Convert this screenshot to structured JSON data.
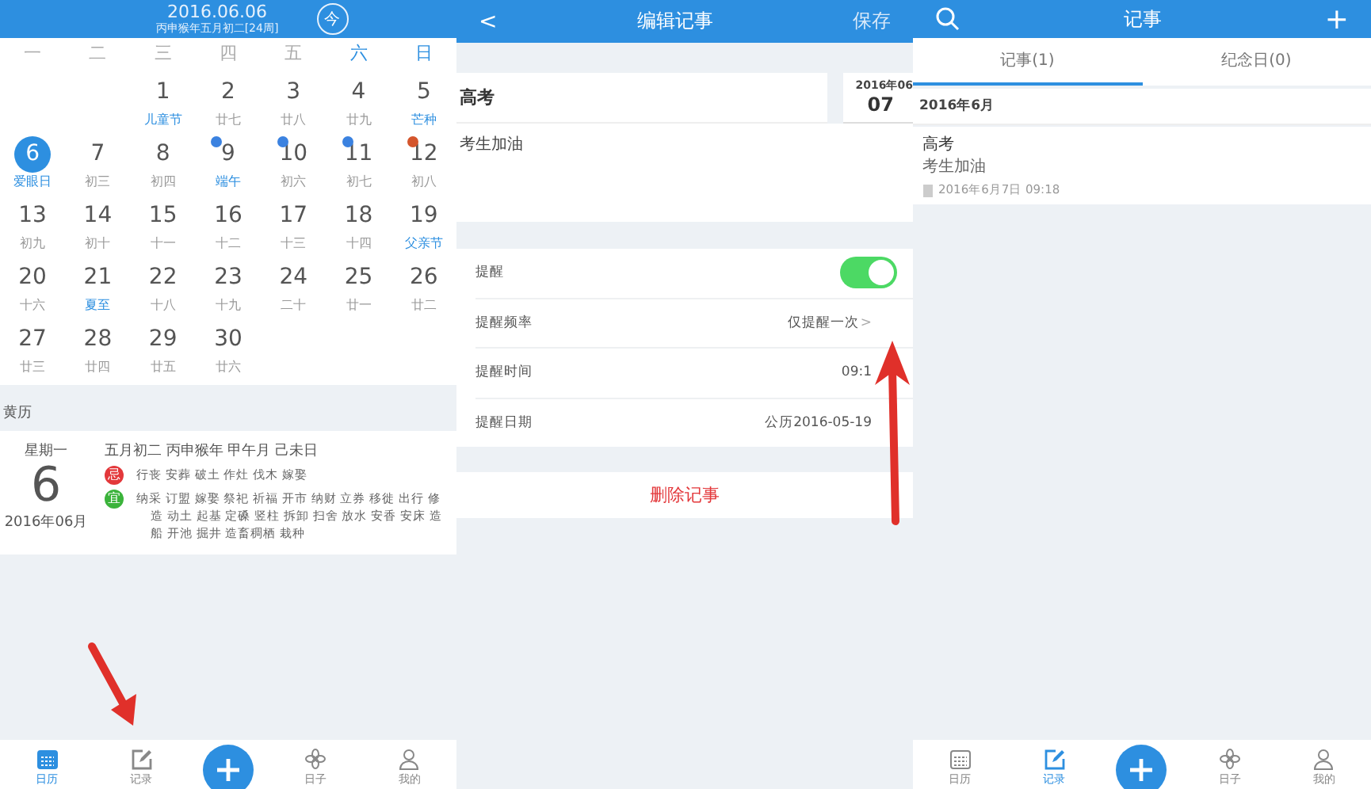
{
  "calendar_screen": {
    "header": {
      "date": "2016.06.06",
      "lunar": "丙申猴年五月初二[24周]",
      "today_button": "今"
    },
    "weekdays": [
      {
        "label": "一",
        "weekend": false
      },
      {
        "label": "二",
        "weekend": false
      },
      {
        "label": "三",
        "weekend": false
      },
      {
        "label": "四",
        "weekend": false
      },
      {
        "label": "五",
        "weekend": false
      },
      {
        "label": "六",
        "weekend": true
      },
      {
        "label": "日",
        "weekend": true
      }
    ],
    "weeks": [
      [
        {
          "kind": "empty"
        },
        {
          "kind": "empty"
        },
        {
          "kind": "day",
          "day": "1",
          "sub": "儿童节",
          "festival": true,
          "selected": false
        },
        {
          "kind": "day",
          "day": "2",
          "sub": "廿七",
          "festival": false,
          "selected": false
        },
        {
          "kind": "day",
          "day": "3",
          "sub": "廿八",
          "festival": false,
          "selected": false
        },
        {
          "kind": "day",
          "day": "4",
          "sub": "廿九",
          "festival": false,
          "selected": false
        },
        {
          "kind": "day",
          "day": "5",
          "sub": "芒种",
          "festival": true,
          "selected": false
        }
      ],
      [
        {
          "kind": "day",
          "day": "6",
          "sub": "爱眼日",
          "festival": true,
          "selected": true
        },
        {
          "kind": "day",
          "day": "7",
          "sub": "初三",
          "festival": false,
          "selected": false
        },
        {
          "kind": "day",
          "day": "8",
          "sub": "初四",
          "festival": false,
          "selected": false
        },
        {
          "kind": "day",
          "day": "9",
          "sub": "端午",
          "festival": true,
          "selected": false,
          "color": "#3b82e0"
        },
        {
          "kind": "day",
          "day": "10",
          "sub": "初六",
          "festival": false,
          "selected": false,
          "color": "#3b82e0"
        },
        {
          "kind": "day",
          "day": "11",
          "sub": "初七",
          "festival": false,
          "selected": false,
          "color": "#3b82e0"
        },
        {
          "kind": "day",
          "day": "12",
          "sub": "初八",
          "festival": false,
          "selected": false,
          "color": "#d4552c"
        }
      ],
      [
        {
          "kind": "day",
          "day": "13",
          "sub": "初九",
          "festival": false,
          "selected": false
        },
        {
          "kind": "day",
          "day": "14",
          "sub": "初十",
          "festival": false,
          "selected": false
        },
        {
          "kind": "day",
          "day": "15",
          "sub": "十一",
          "festival": false,
          "selected": false
        },
        {
          "kind": "day",
          "day": "16",
          "sub": "十二",
          "festival": false,
          "selected": false
        },
        {
          "kind": "day",
          "day": "17",
          "sub": "十三",
          "festival": false,
          "selected": false
        },
        {
          "kind": "day",
          "day": "18",
          "sub": "十四",
          "festival": false,
          "selected": false
        },
        {
          "kind": "day",
          "day": "19",
          "sub": "父亲节",
          "festival": true,
          "selected": false
        }
      ],
      [
        {
          "kind": "day",
          "day": "20",
          "sub": "十六",
          "festival": false,
          "selected": false
        },
        {
          "kind": "day",
          "day": "21",
          "sub": "夏至",
          "festival": true,
          "selected": false
        },
        {
          "kind": "day",
          "day": "22",
          "sub": "十八",
          "festival": false,
          "selected": false
        },
        {
          "kind": "day",
          "day": "23",
          "sub": "十九",
          "festival": false,
          "selected": false
        },
        {
          "kind": "day",
          "day": "24",
          "sub": "二十",
          "festival": false,
          "selected": false
        },
        {
          "kind": "day",
          "day": "25",
          "sub": "廿一",
          "festival": false,
          "selected": false
        },
        {
          "kind": "day",
          "day": "26",
          "sub": "廿二",
          "festival": false,
          "selected": false
        }
      ],
      [
        {
          "kind": "day",
          "day": "27",
          "sub": "廿三",
          "festival": false,
          "selected": false
        },
        {
          "kind": "day",
          "day": "28",
          "sub": "廿四",
          "festival": false,
          "selected": false
        },
        {
          "kind": "day",
          "day": "29",
          "sub": "廿五",
          "festival": false,
          "selected": false
        },
        {
          "kind": "day",
          "day": "30",
          "sub": "廿六",
          "festival": false,
          "selected": false
        },
        {
          "kind": "empty"
        },
        {
          "kind": "empty"
        },
        {
          "kind": "empty"
        }
      ]
    ],
    "almanac": {
      "title": "黄历",
      "weekday": "星期一",
      "day": "6",
      "month": "2016年06月",
      "lunar": "五月初二 丙申猴年 甲午月 己未日",
      "lines": [
        {
          "kind": "avoid",
          "badge": "忌",
          "text": "行丧 安葬 破土 作灶 伐木 嫁娶"
        },
        {
          "kind": "suit",
          "badge": "宜",
          "text": "纳采 订盟 嫁娶 祭祀 祈福 开市 纳财 立券 移徙 出行 修造 动土 起基 定磉 竖柱 拆卸 扫舍 放水 安香 安床 造船 开池 掘井 造畜稠栖 栽种"
        }
      ]
    },
    "tabbar": [
      {
        "kind": "calendar",
        "label": "日历",
        "selected": true
      },
      {
        "kind": "note",
        "label": "记录",
        "selected": false
      },
      {
        "kind": "add"
      },
      {
        "kind": "pinwheel",
        "label": "日子",
        "selected": false
      },
      {
        "kind": "person",
        "label": "我的",
        "selected": false
      }
    ]
  },
  "edit_screen": {
    "header": {
      "back": "<",
      "title": "编辑记事",
      "save": "保存"
    },
    "title_value": "高考",
    "date_month": "2016年06",
    "date_day": "07",
    "content_value": "考生加油",
    "settings": [
      {
        "kind": "toggle",
        "label": "提醒",
        "on": true
      },
      {
        "kind": "value",
        "label": "提醒频率",
        "value": "仅提醒一次",
        "chevron": ">"
      },
      {
        "kind": "value",
        "label": "提醒时间",
        "value": "09:1"
      },
      {
        "kind": "value",
        "label": "提醒日期",
        "value": "公历2016-05-19"
      }
    ],
    "delete_button": "删除记事"
  },
  "notes_screen": {
    "header": {
      "title": "记事",
      "add": "+"
    },
    "tabs": [
      {
        "label": "记事(1)",
        "selected": true
      },
      {
        "label": "纪念日(0)",
        "selected": false
      }
    ],
    "section": "2016年6月",
    "notes": [
      {
        "title": "高考",
        "content": "考生加油",
        "time": "2016年6月7日 09:18"
      }
    ],
    "tabbar": [
      {
        "kind": "calendar",
        "label": "日历",
        "selected": false
      },
      {
        "kind": "note",
        "label": "记录",
        "selected": true
      },
      {
        "kind": "add"
      },
      {
        "kind": "pinwheel",
        "label": "日子",
        "selected": false
      },
      {
        "kind": "person",
        "label": "我的",
        "selected": false
      }
    ]
  }
}
